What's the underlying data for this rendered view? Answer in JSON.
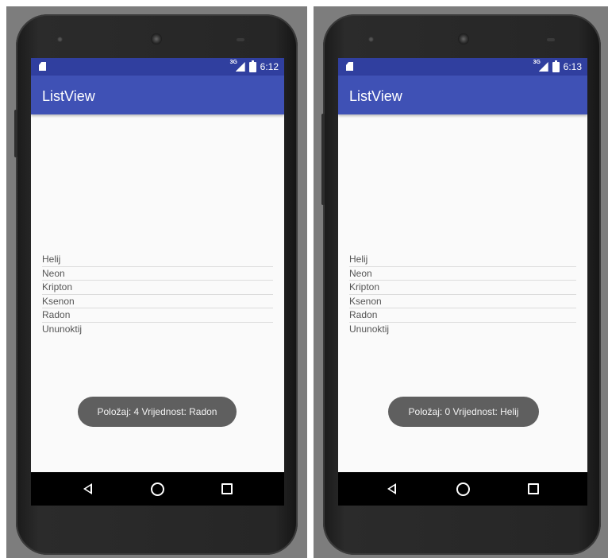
{
  "phones": [
    {
      "status_time": "6:12",
      "network_label": "3G",
      "app_title": "ListView",
      "list_items": [
        "Helij",
        "Neon",
        "Kripton",
        "Ksenon",
        "Radon",
        "Ununoktij"
      ],
      "toast_text": "Položaj: 4 Vrijednost: Radon"
    },
    {
      "status_time": "6:13",
      "network_label": "3G",
      "app_title": "ListView",
      "list_items": [
        "Helij",
        "Neon",
        "Kripton",
        "Ksenon",
        "Radon",
        "Ununoktij"
      ],
      "toast_text": "Položaj: 0 Vrijednost: Helij"
    }
  ],
  "colors": {
    "status_bar": "#303f9f",
    "app_bar": "#3f51b5",
    "screen_background": "#fafafa",
    "toast_background": "#5f5f5f",
    "nav_bar": "#000000"
  },
  "icons": {
    "status_left": "sd-card-icon",
    "status_signal": "signal-icon",
    "status_battery": "battery-icon",
    "nav_back": "back-triangle-icon",
    "nav_home": "home-circle-icon",
    "nav_recents": "recents-square-icon"
  }
}
